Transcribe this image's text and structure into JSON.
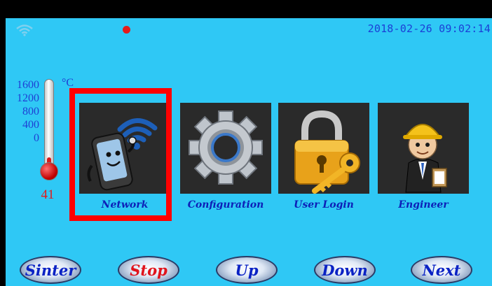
{
  "status_bar": {
    "datetime": "2018-02-26 09:02:14"
  },
  "thermometer": {
    "scale": [
      "1600",
      "1200",
      "800",
      "400",
      "0"
    ],
    "unit": "°C",
    "value": "41",
    "max": 1600
  },
  "menu": {
    "items": [
      {
        "label": "Network",
        "icon": "phone-wifi-icon",
        "selected": true
      },
      {
        "label": "Configuration",
        "icon": "gear-icon",
        "selected": false
      },
      {
        "label": "User Login",
        "icon": "padlock-key-icon",
        "selected": false
      },
      {
        "label": "Engineer",
        "icon": "engineer-icon",
        "selected": false
      }
    ]
  },
  "buttons": {
    "sinter": "Sinter",
    "stop": "Stop",
    "up": "Up",
    "down": "Down",
    "next": "Next"
  },
  "colors": {
    "background": "#2fc8f5",
    "label_blue": "#0d20b8",
    "selection_red": "#ff0000",
    "stop_red": "#e0141c"
  }
}
